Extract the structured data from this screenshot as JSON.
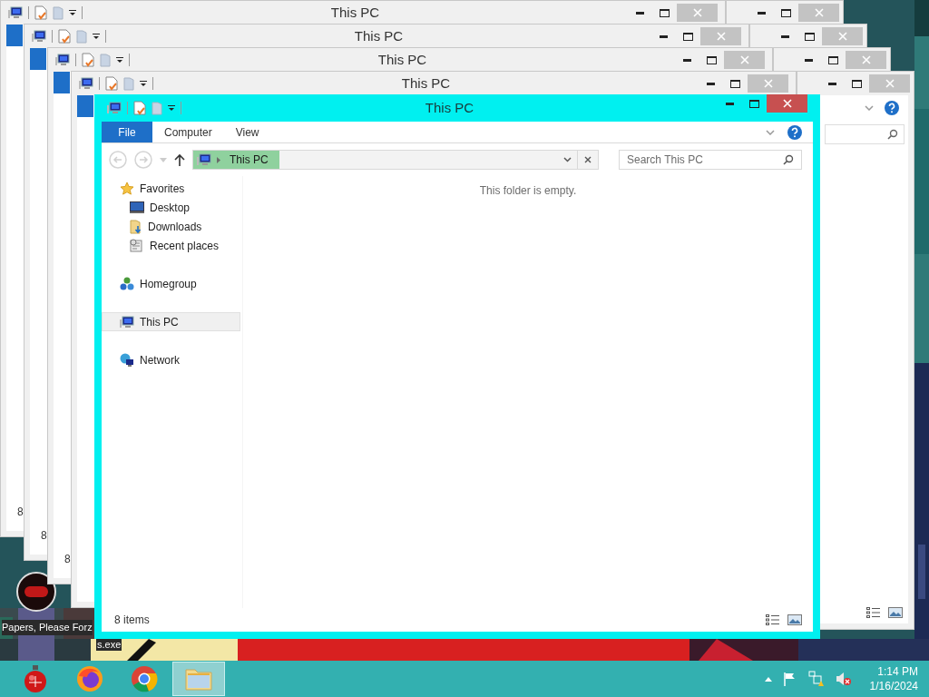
{
  "back_windows": [
    {
      "title": "This PC",
      "status": "8"
    },
    {
      "title": "This PC",
      "status": "8"
    },
    {
      "title": "This PC",
      "status": "8"
    },
    {
      "title": "This PC"
    }
  ],
  "desktop_icon": {
    "label_lines": [
      "Papers, Please Forz",
      "s.exe"
    ]
  },
  "window": {
    "title": "This PC",
    "ribbon_tabs": [
      {
        "label": "File",
        "kind": "file"
      },
      {
        "label": "Computer",
        "kind": "tab"
      },
      {
        "label": "View",
        "kind": "tab"
      }
    ],
    "address": {
      "crumb": "This PC"
    },
    "search": {
      "placeholder": "Search This PC"
    },
    "nav": [
      {
        "label": "Favorites",
        "kind": "star",
        "selected": false,
        "children": [
          {
            "label": "Desktop",
            "kind": "desktop",
            "selected": false
          },
          {
            "label": "Downloads",
            "kind": "downloads",
            "selected": false
          },
          {
            "label": "Recent places",
            "kind": "recent",
            "selected": false
          }
        ]
      },
      {
        "label": "Homegroup",
        "kind": "homegroup",
        "selected": false
      },
      {
        "label": "This PC",
        "kind": "pc",
        "selected": true
      },
      {
        "label": "Network",
        "kind": "network",
        "selected": false
      }
    ],
    "empty_message": "This folder is empty.",
    "status": "8 items"
  },
  "taskbar": {
    "apps": [
      {
        "kind": "ornament",
        "active": false
      },
      {
        "kind": "firefox",
        "active": false
      },
      {
        "kind": "chrome",
        "active": false
      },
      {
        "kind": "explorer",
        "active": true
      }
    ],
    "time": "1:14 PM",
    "date": "1/16/2024"
  }
}
